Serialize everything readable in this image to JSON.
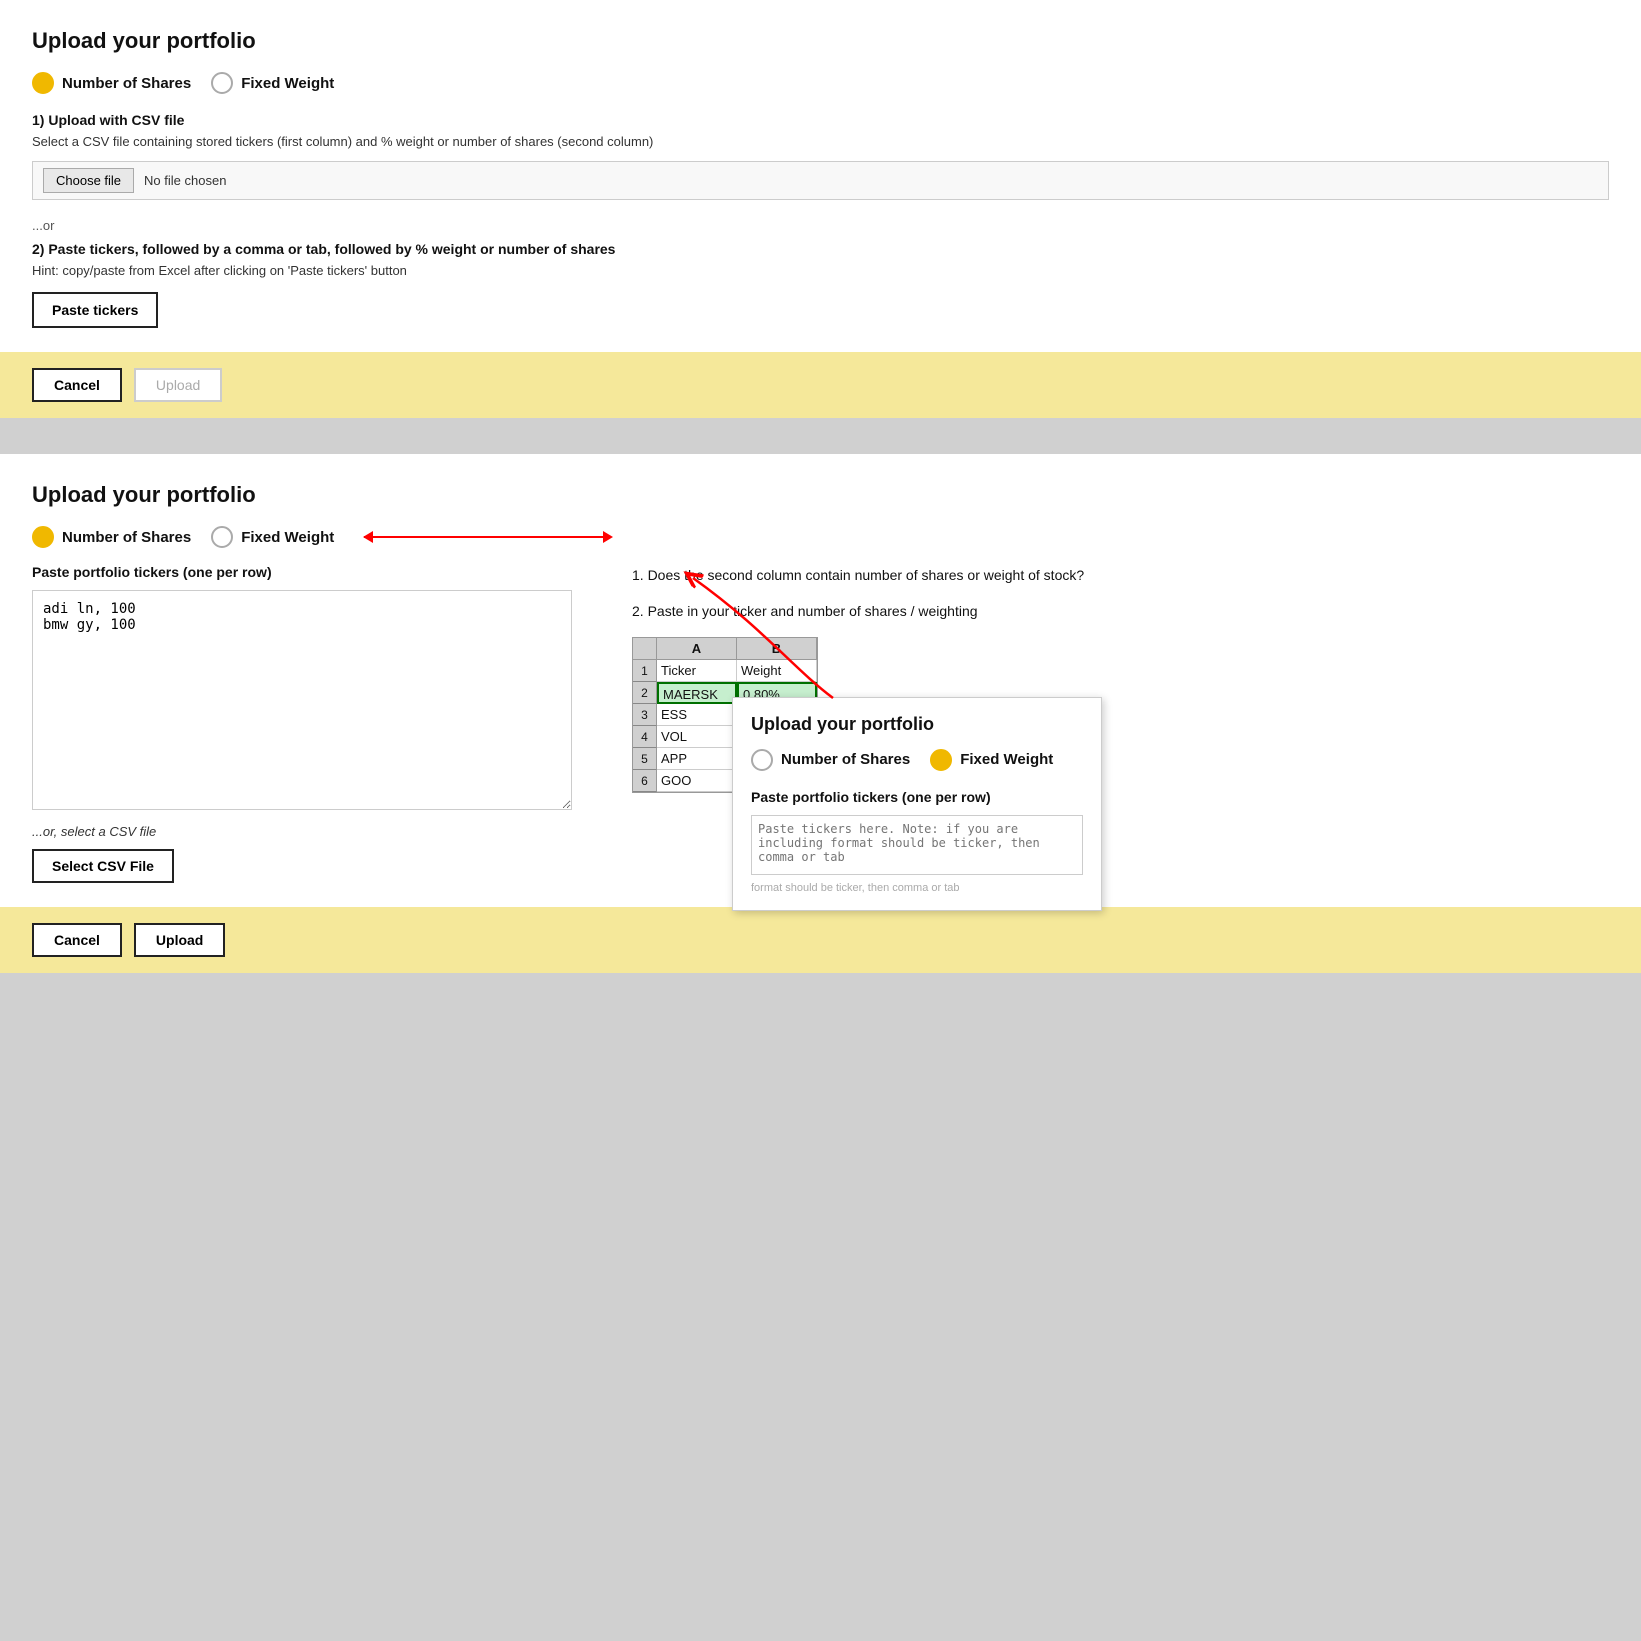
{
  "panel1": {
    "title": "Upload your portfolio",
    "radio": {
      "shares_label": "Number of Shares",
      "weight_label": "Fixed Weight",
      "shares_selected": true
    },
    "upload_csv_heading": "1) Upload with CSV file",
    "upload_csv_desc": "Select a CSV file containing stored tickers (first column) and % weight or number of shares (second column)",
    "choose_file_label": "Choose file",
    "no_file_label": "No file chosen",
    "or_text": "...or",
    "paste_heading": "2) Paste tickers, followed by a comma or tab, followed by % weight or number of shares",
    "paste_hint": "Hint: copy/paste from Excel after clicking on 'Paste tickers' button",
    "paste_btn_label": "Paste tickers",
    "cancel_label": "Cancel",
    "upload_label": "Upload"
  },
  "panel2": {
    "title": "Upload your portfolio",
    "radio": {
      "shares_label": "Number of Shares",
      "weight_label": "Fixed Weight",
      "shares_selected": true
    },
    "paste_label": "Paste portfolio tickers (one per row)",
    "textarea_value": "adi ln, 100\nbmw gy, 100",
    "or_csv_text": "...or, select a CSV file",
    "select_csv_label": "Select CSV File",
    "cancel_label": "Cancel",
    "upload_label": "Upload",
    "right_col": {
      "instruction1": "1. Does the second column contain number of shares or weight of stock?",
      "instruction2": "2. Paste in your ticker and number of shares / weighting"
    },
    "excel_table": {
      "col_headers": [
        "A",
        "B"
      ],
      "row_headers": [
        "1",
        "2",
        "3",
        "4",
        "5",
        "6"
      ],
      "rows": [
        [
          "Ticker",
          "Weight"
        ],
        [
          "MAERSK",
          "0.80%"
        ],
        [
          "ESS",
          ""
        ],
        [
          "VOL",
          ""
        ],
        [
          "APP",
          ""
        ],
        [
          "GOO",
          ""
        ]
      ]
    },
    "overlay": {
      "title": "Upload your portfolio",
      "shares_label": "Number of Shares",
      "weight_label": "Fixed Weight",
      "weight_selected": true,
      "paste_label": "Paste portfolio tickers (one per row)",
      "textarea_placeholder": "Paste tickers here. Note: if you are including format should be ticker, then comma or tab"
    }
  }
}
